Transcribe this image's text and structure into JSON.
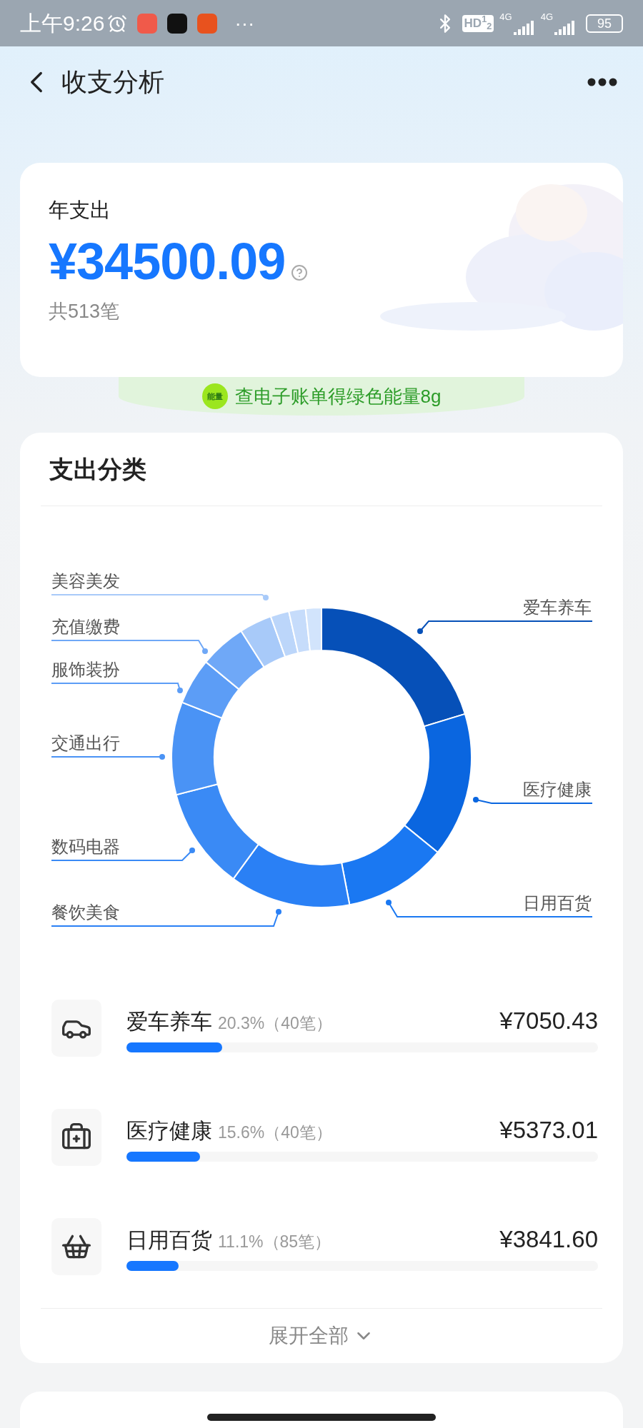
{
  "status_bar": {
    "time": "上午9:26",
    "more": "···",
    "hd": "HD$^{1}$$_{2}$",
    "networks": [
      "4G",
      "4G"
    ],
    "battery": "95"
  },
  "header": {
    "title": "收支分析"
  },
  "summary": {
    "label": "年支出",
    "amount": "¥34500.09",
    "count": "共513笔"
  },
  "energy_banner": {
    "badge": "能量",
    "text": "查电子账单得绿色能量8g"
  },
  "category_card": {
    "title": "支出分类",
    "chart": {
      "labels": [
        {
          "text": "美容美发",
          "color": "#a8caf9"
        },
        {
          "text": "爱车养车",
          "color": "#0650b8"
        },
        {
          "text": "充值缴费",
          "color": "#6fa8f7"
        },
        {
          "text": "服饰装扮",
          "color": "#5c9df6"
        },
        {
          "text": "交通出行",
          "color": "#4a93f5"
        },
        {
          "text": "医疗健康",
          "color": "#0a66e0"
        },
        {
          "text": "数码电器",
          "color": "#3a8af5"
        },
        {
          "text": "餐饮美食",
          "color": "#2a80f5"
        },
        {
          "text": "日用百货",
          "color": "#1a78f2"
        }
      ]
    },
    "rows": [
      {
        "kind": "car",
        "name": "爱车养车",
        "percent": "20.3%（40笔）",
        "amount": "¥7050.43",
        "level": 0.203
      },
      {
        "kind": "medical",
        "name": "医疗健康",
        "percent": "15.6%（40笔）",
        "amount": "¥5373.01",
        "level": 0.156
      },
      {
        "kind": "basket",
        "name": "日用百货",
        "percent": "11.1%（85笔）",
        "amount": "¥3841.60",
        "level": 0.111
      }
    ],
    "expand": "展开全部"
  }
}
